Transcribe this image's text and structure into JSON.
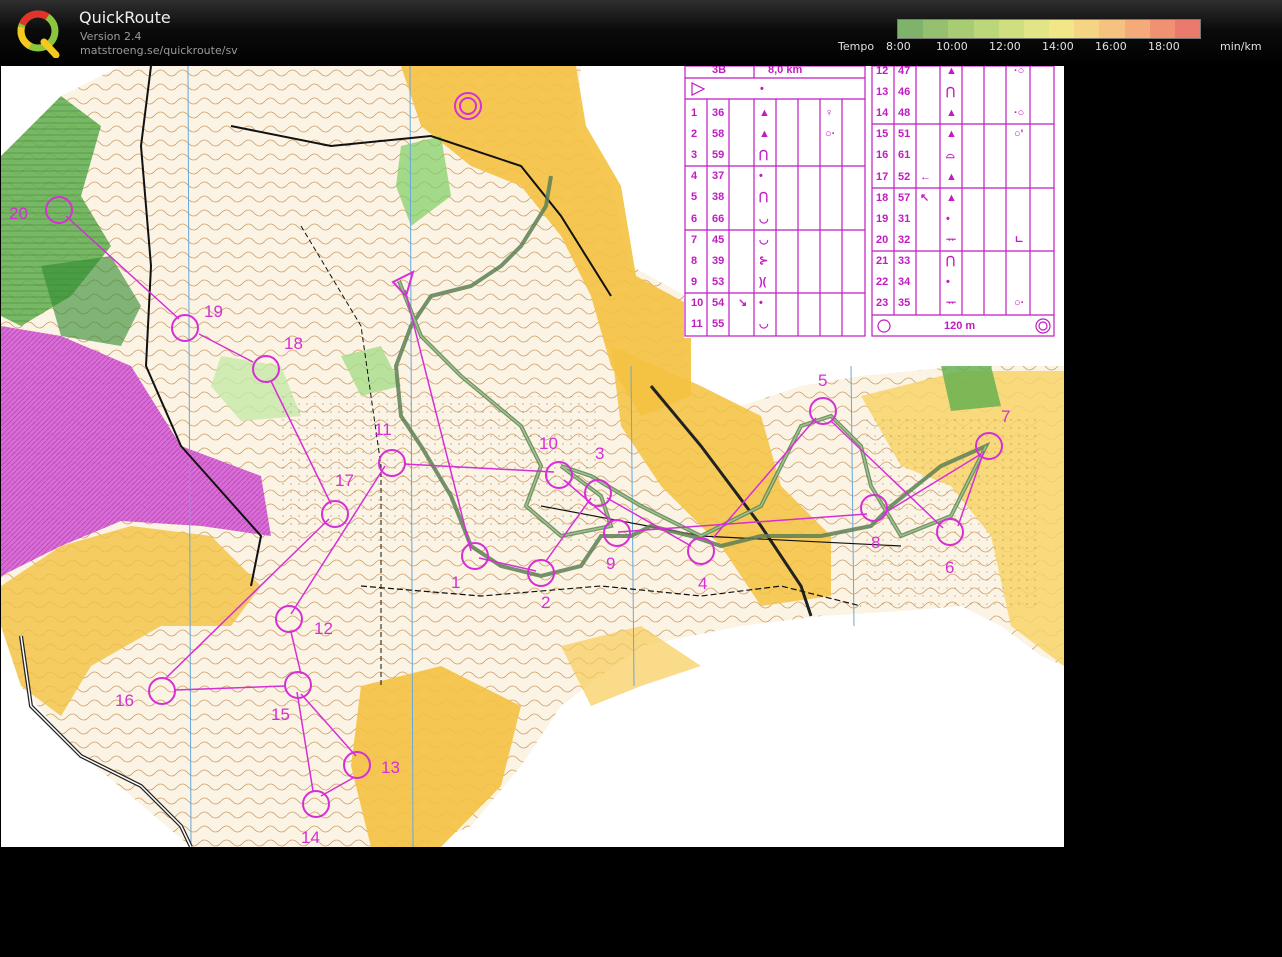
{
  "app": {
    "title": "QuickRoute",
    "version": "Version 2.4",
    "url": "matstroeng.se/quickroute/sv"
  },
  "tempo": {
    "label": "Tempo",
    "ticks": [
      "8:00",
      "10:00",
      "12:00",
      "14:00",
      "16:00",
      "18:00"
    ],
    "unit": "min/km",
    "colors": [
      "#7fb26a",
      "#94c070",
      "#a8cc74",
      "#bcd67a",
      "#cfdf80",
      "#e2e585",
      "#f1e787",
      "#f5d584",
      "#f6c27f",
      "#f4ab79",
      "#f09272",
      "#ea7a6c"
    ]
  },
  "description": {
    "class": "3B",
    "length": "8,0 km",
    "left": [
      {
        "num": "1",
        "code": "36",
        "f1": "▲",
        "f2": "",
        "f3": "♀"
      },
      {
        "num": "2",
        "code": "58",
        "f1": "▲",
        "f2": "",
        "f3": "○·"
      },
      {
        "num": "3",
        "code": "59",
        "f1": "⋂",
        "f2": "",
        "f3": ""
      },
      {
        "num": "4",
        "code": "37",
        "f1": "•",
        "f2": "",
        "f3": ""
      },
      {
        "num": "5",
        "code": "38",
        "f1": "⋂",
        "f2": "",
        "f3": ""
      },
      {
        "num": "6",
        "code": "66",
        "f1": "◡",
        "f2": "",
        "f3": ""
      },
      {
        "num": "7",
        "code": "45",
        "f1": "◡",
        "f2": "",
        "f3": ""
      },
      {
        "num": "8",
        "code": "39",
        "f1": "⊱",
        "f2": "",
        "f3": ""
      },
      {
        "num": "9",
        "code": "53",
        "f1": ")(",
        "f2": "",
        "f3": ""
      },
      {
        "num": "10",
        "code": "54",
        "f0": "↘",
        "f1": "•",
        "f2": "",
        "f3": ""
      },
      {
        "num": "11",
        "code": "55",
        "f1": "◡",
        "f2": "",
        "f3": ""
      }
    ],
    "right": [
      {
        "num": "12",
        "code": "47",
        "f1": "▲",
        "f3": "·○"
      },
      {
        "num": "13",
        "code": "46",
        "f1": "⋂",
        "f3": ""
      },
      {
        "num": "14",
        "code": "48",
        "f1": "▲",
        "f3": "·○"
      },
      {
        "num": "15",
        "code": "51",
        "f1": "▲",
        "f3": "○'"
      },
      {
        "num": "16",
        "code": "61",
        "f1": "⌓",
        "f3": ""
      },
      {
        "num": "17",
        "code": "52",
        "f0": "←",
        "f1": "▲",
        "f3": ""
      },
      {
        "num": "18",
        "code": "57",
        "f0": "↖",
        "f1": "▲",
        "f3": ""
      },
      {
        "num": "19",
        "code": "31",
        "f1": "•",
        "f3": ""
      },
      {
        "num": "20",
        "code": "32",
        "f1": "ᅲ",
        "f3": "ㄴ"
      },
      {
        "num": "21",
        "code": "33",
        "f1": "⋂",
        "f3": ""
      },
      {
        "num": "22",
        "code": "34",
        "f1": "•",
        "f3": ""
      },
      {
        "num": "23",
        "code": "35",
        "f1": "ᅲ",
        "f3": "○·"
      }
    ],
    "finish_distance": "120 m"
  },
  "controls": [
    {
      "label": "1"
    },
    {
      "label": "2"
    },
    {
      "label": "3"
    },
    {
      "label": "4"
    },
    {
      "label": "5"
    },
    {
      "label": "6"
    },
    {
      "label": "7"
    },
    {
      "label": "8"
    },
    {
      "label": "9"
    },
    {
      "label": "10"
    },
    {
      "label": "11"
    },
    {
      "label": "12"
    },
    {
      "label": "13"
    },
    {
      "label": "14"
    },
    {
      "label": "15"
    },
    {
      "label": "16"
    },
    {
      "label": "17"
    },
    {
      "label": "18"
    },
    {
      "label": "19"
    },
    {
      "label": "20"
    }
  ]
}
